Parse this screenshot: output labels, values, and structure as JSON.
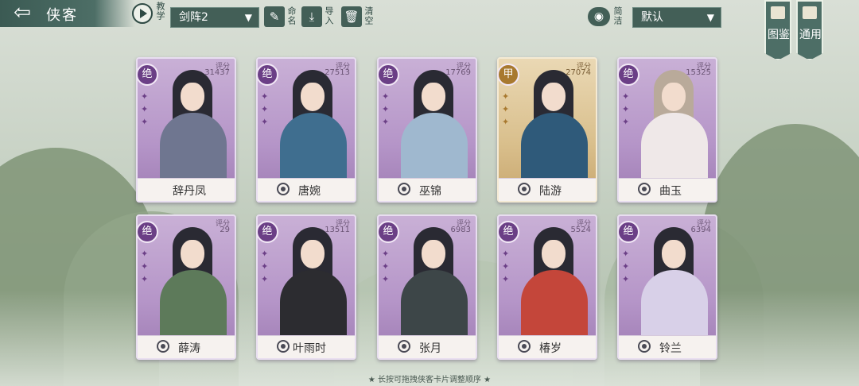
{
  "header": {
    "back_icon": "arrow-left-icon",
    "title": "侠客",
    "teach_label": "教学",
    "formation_select": "剑阵2",
    "rename_label": "命名",
    "import_label": "导入",
    "clear_label": "清空",
    "concise_label": "简洁",
    "sort_select": "默认",
    "codex_label": "图鉴",
    "general_label": "通用"
  },
  "cards": [
    {
      "rank": "绝",
      "score_label": "评分",
      "score": "31437",
      "name": "辞丹凤",
      "tier": "purple"
    },
    {
      "rank": "绝",
      "score_label": "评分",
      "score": "27513",
      "name": "唐婉",
      "tier": "purple"
    },
    {
      "rank": "绝",
      "score_label": "评分",
      "score": "17769",
      "name": "巫锦",
      "tier": "purple"
    },
    {
      "rank": "甲",
      "score_label": "评分",
      "score": "27074",
      "name": "陆游",
      "tier": "gold"
    },
    {
      "rank": "绝",
      "score_label": "评分",
      "score": "15325",
      "name": "曲玉",
      "tier": "purple"
    },
    {
      "rank": "绝",
      "score_label": "评分",
      "score": "29",
      "name": "薛涛",
      "tier": "purple"
    },
    {
      "rank": "绝",
      "score_label": "评分",
      "score": "13511",
      "name": "叶雨时",
      "tier": "purple"
    },
    {
      "rank": "绝",
      "score_label": "评分",
      "score": "6983",
      "name": "张月",
      "tier": "purple"
    },
    {
      "rank": "绝",
      "score_label": "评分",
      "score": "5524",
      "name": "椿岁",
      "tier": "purple"
    },
    {
      "rank": "绝",
      "score_label": "评分",
      "score": "6394",
      "name": "铃兰",
      "tier": "purple"
    }
  ],
  "footer": {
    "hint": "★ 长按可拖拽侠客卡片调整顺序 ★"
  },
  "colors": {
    "accent": "#435f57",
    "purple_card": "#b595c8",
    "gold_card": "#d9bf8c"
  }
}
